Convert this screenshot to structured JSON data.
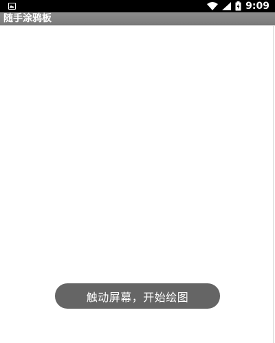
{
  "status_bar": {
    "time": "9:09",
    "icons": [
      "notification-image-icon",
      "wifi-icon",
      "signal-icon",
      "battery-charging-icon"
    ]
  },
  "app": {
    "title": "随手涂鸦板"
  },
  "toast": {
    "message": "触动屏幕，开始绘图"
  },
  "colors": {
    "status_bar_bg": "#000000",
    "title_bar_bg": "#848484",
    "toast_bg": "#656565",
    "canvas_bg": "#ffffff"
  }
}
